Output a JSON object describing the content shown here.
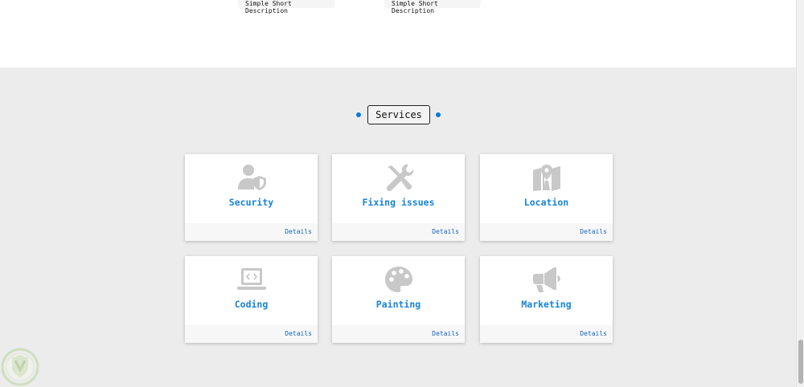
{
  "top_section": {
    "snippets": [
      {
        "text": "Simple Short\nDescription"
      },
      {
        "text": "Simple Short\nDescription"
      }
    ]
  },
  "services": {
    "title": "Services",
    "accent_color": "#0a7ad6",
    "cards": [
      {
        "title": "Security",
        "icon": "user-shield-icon",
        "details_label": "Details"
      },
      {
        "title": "Fixing issues",
        "icon": "tools-icon",
        "details_label": "Details"
      },
      {
        "title": "Location",
        "icon": "map-location-icon",
        "details_label": "Details"
      },
      {
        "title": "Coding",
        "icon": "laptop-code-icon",
        "details_label": "Details"
      },
      {
        "title": "Painting",
        "icon": "palette-icon",
        "details_label": "Details"
      },
      {
        "title": "Marketing",
        "icon": "megaphone-icon",
        "details_label": "Details"
      }
    ]
  },
  "colors": {
    "card_title": "#1784d8",
    "icon_gray": "#c8c8c8",
    "details_link": "#1565c0"
  }
}
